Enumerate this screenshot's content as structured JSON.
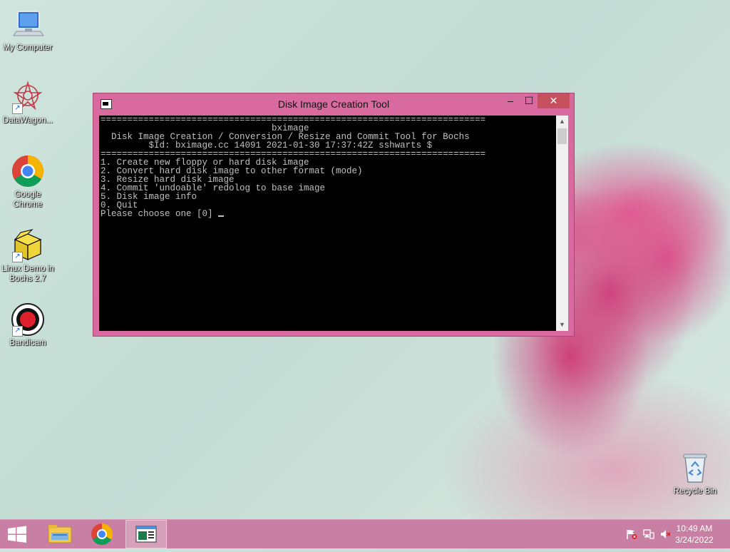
{
  "desktop": {
    "icons": [
      {
        "label": "My Computer",
        "icon": "computer-icon"
      },
      {
        "label": "DataWagon...",
        "icon": "datawagon-icon"
      },
      {
        "label": "Google Chrome",
        "icon": "chrome-icon"
      },
      {
        "label": "Linux Demo in Bochs 2.7",
        "icon": "package-box-icon"
      },
      {
        "label": "Bandicam",
        "icon": "record-icon"
      },
      {
        "label": "Recycle Bin",
        "icon": "recycle-bin-icon"
      }
    ]
  },
  "window": {
    "title": "Disk Image Creation Tool",
    "controls": {
      "minimize": "–",
      "maximize": "☐",
      "close": "✕"
    },
    "console_lines": [
      "========================================================================",
      "                                bximage",
      "  Disk Image Creation / Conversion / Resize and Commit Tool for Bochs",
      "         $Id: bximage.cc 14091 2021-01-30 17:37:42Z sshwarts $",
      "========================================================================",
      "",
      "1. Create new floppy or hard disk image",
      "2. Convert hard disk image to other format (mode)",
      "3. Resize hard disk image",
      "4. Commit 'undoable' redolog to base image",
      "5. Disk image info",
      "",
      "0. Quit",
      "",
      "Please choose one [0] "
    ]
  },
  "taskbar": {
    "items": [
      "windows-start-icon",
      "file-explorer-icon",
      "chrome-icon",
      "console-window-icon"
    ],
    "tray": [
      "action-center-flag-icon",
      "network-icon",
      "volume-muted-icon"
    ],
    "time": "10:49 AM",
    "date": "3/24/2022"
  },
  "colors": {
    "window_frame": "#d86aa0",
    "close_button": "#c7505f",
    "taskbar": "#c87fa3",
    "console_bg": "#000000",
    "console_text": "#c0c0c0"
  }
}
